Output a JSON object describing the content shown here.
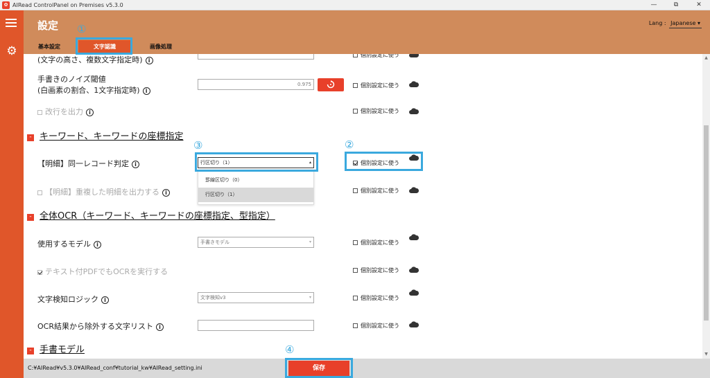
{
  "window": {
    "title": "AIRead ControlPanel on Premises v5.3.0",
    "minimize": "—",
    "restore": "⧉",
    "close": "✕"
  },
  "header": {
    "title": "設定",
    "lang_label": "Lang :",
    "lang_value": "Japanese"
  },
  "tabs": [
    {
      "label": "基本設定"
    },
    {
      "label": "文字認識",
      "active": true
    },
    {
      "label": "画像処理"
    }
  ],
  "markers": [
    "①",
    "②",
    "③",
    "④"
  ],
  "rows": {
    "partial_label": "(文字の高さ、複数文字指定時)",
    "noise_label_1": "手書きのノイズ閾値",
    "noise_label_2": "(白画素の割合、1文字指定時)",
    "noise_value": "0.975",
    "newline_label": "改行を出力",
    "same_record_label": "【明細】同一レコード判定",
    "same_record_value": "行区切り（1）",
    "duplicate_label": "【明細】重複した明細を出力する",
    "model_label": "使用するモデル",
    "model_value": "手書きモデル",
    "pdf_ocr_label": "テキスト付PDFでもOCRを実行する",
    "logic_label": "文字検知ロジック",
    "logic_value": "文字検知v3",
    "exclude_label": "OCR結果から除外する文字リスト",
    "exclude_value": ""
  },
  "individual_setting_label": "個別設定に使う",
  "sections": {
    "keyword": "キーワード、キーワードの座標指定",
    "full_ocr": "全体OCR（キーワード、キーワードの座標指定、型指定）",
    "handwriting": "手書モデル"
  },
  "dropdown_options": [
    "罫線区切り（0）",
    "行区切り（1）"
  ],
  "footer": {
    "path": "C:¥AIRead¥v5.3.0¥AIRead_conf¥tutorial_kw¥AIRead_setting.ini",
    "save_label": "保存"
  },
  "colors": {
    "accent": "#e0562a",
    "header": "#d08b5b",
    "marker": "#3aa9de",
    "button": "#e8402a"
  }
}
